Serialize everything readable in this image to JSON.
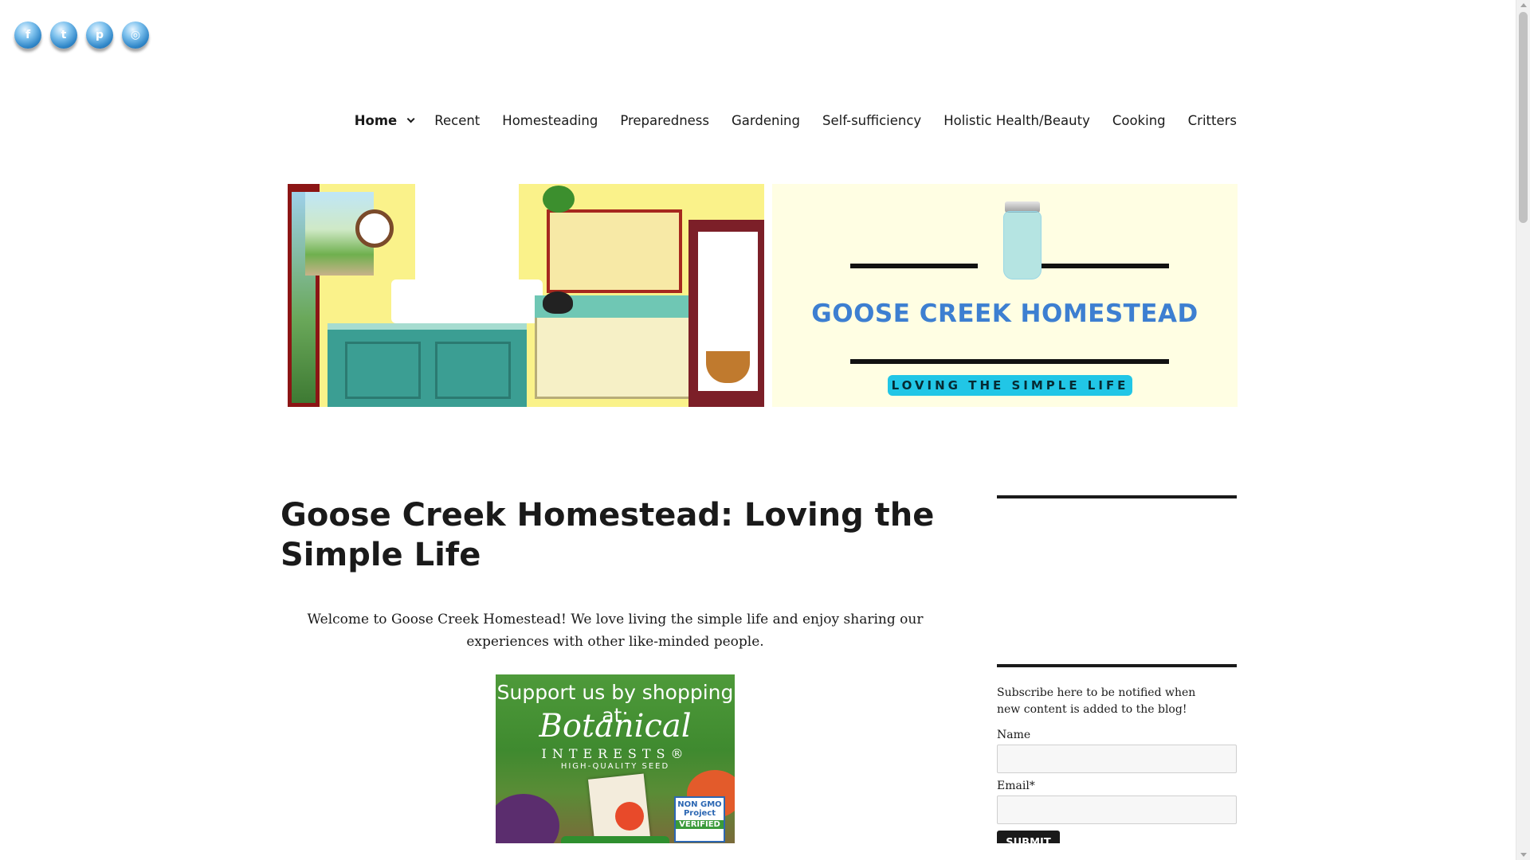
{
  "social": {
    "icons": [
      {
        "name": "facebook-icon",
        "glyph": "f"
      },
      {
        "name": "twitter-icon",
        "glyph": "t"
      },
      {
        "name": "pinterest-icon",
        "glyph": "p"
      },
      {
        "name": "instagram-icon",
        "glyph": "◎"
      }
    ]
  },
  "nav": {
    "items": [
      {
        "label": "Home",
        "active": true
      },
      {
        "label": "Recent"
      },
      {
        "label": "Homesteading"
      },
      {
        "label": "Preparedness"
      },
      {
        "label": "Gardening"
      },
      {
        "label": "Self-sufficiency"
      },
      {
        "label": "Holistic Health/Beauty"
      },
      {
        "label": "Cooking"
      },
      {
        "label": "Critters"
      }
    ]
  },
  "banner": {
    "brand_title": "GOOSE CREEK HOMESTEAD",
    "brand_tagline": "LOVING THE SIMPLE LIFE",
    "title_color": "#3d7fd1",
    "tag_color": "#21c6e6"
  },
  "main": {
    "title": "Goose Creek Homestead: Loving the Simple Life",
    "intro": "Welcome to Goose Creek Homestead! We love living the simple life and enjoy sharing our experiences with other like-minded people."
  },
  "ad": {
    "line1": "Support us by shopping at:",
    "brand": "Botanical",
    "brand_sub": "INTERESTS®",
    "brand_tag": "HIGH-QUALITY SEED",
    "badge_top": "NON GMO Project",
    "badge_bottom": "VERIFIED"
  },
  "sidebar": {
    "subscribe_text": "Subscribe here to be notified when new content is added to the blog!",
    "name_label": "Name",
    "email_label": "Email*",
    "name_value": "",
    "email_value": "",
    "submit_label": "SUBMIT"
  }
}
